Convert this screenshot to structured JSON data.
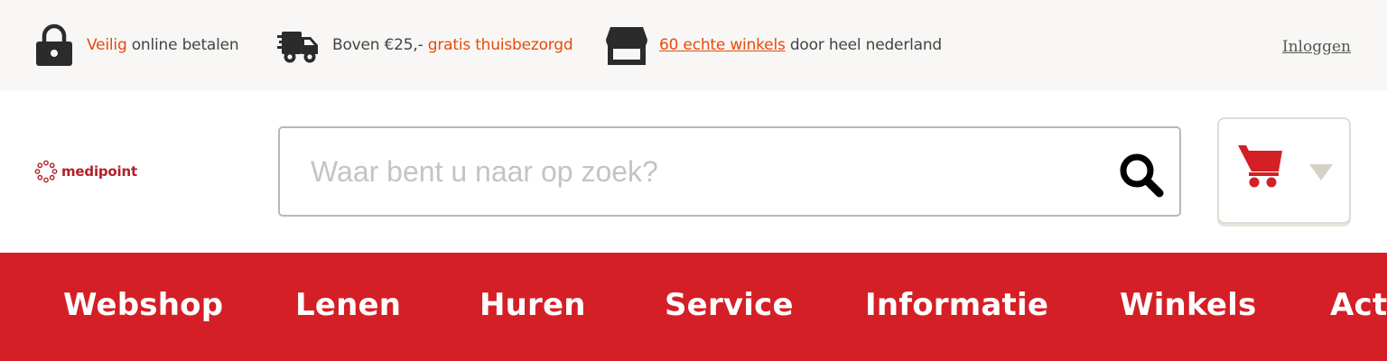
{
  "topbar": {
    "usp_payment": {
      "highlight": "Veilig",
      "text": " online betalen",
      "icon": "lock-icon"
    },
    "usp_delivery": {
      "text": "Boven €25,- ",
      "highlight": "gratis thuisbezorgd",
      "icon": "delivery-truck-icon"
    },
    "usp_stores": {
      "link": "60 echte winkels",
      "text": " door heel nederland",
      "icon": "storefront-icon"
    },
    "login_label": "Inloggen"
  },
  "header": {
    "logo_text": "medipoint",
    "search": {
      "placeholder": "Waar bent u naar op zoek?",
      "value": "",
      "icon": "search-icon"
    },
    "cart": {
      "icon": "shopping-cart-icon",
      "dropdown_icon": "caret-down-icon"
    }
  },
  "nav": {
    "items": [
      {
        "label": "Webshop"
      },
      {
        "label": "Lenen"
      },
      {
        "label": "Huren"
      },
      {
        "label": "Service"
      },
      {
        "label": "Informatie"
      },
      {
        "label": "Winkels"
      },
      {
        "label": "Acties"
      }
    ]
  },
  "colors": {
    "accent_orange": "#e84a0c",
    "brand_red": "#d41f26",
    "logo_red": "#b3202a",
    "cart_red": "#d41f26",
    "topbar_bg": "#f8f7f5"
  }
}
